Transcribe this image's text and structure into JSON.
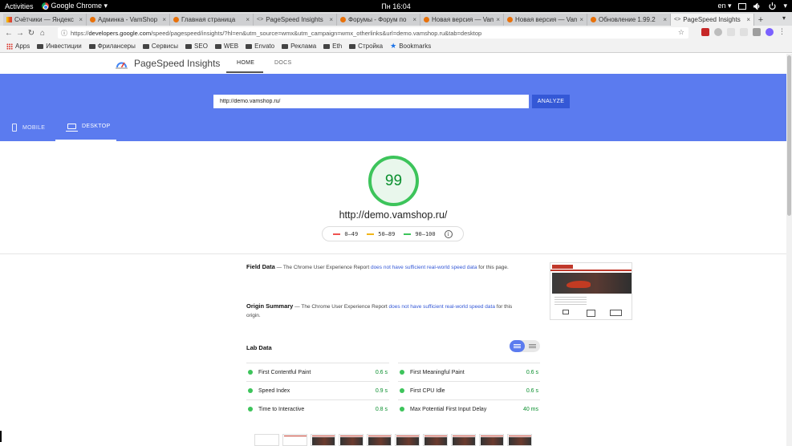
{
  "gnome": {
    "activities": "Activities",
    "app": "Google Chrome ▾",
    "clock": "Пн 16:04",
    "lang": "en ▾"
  },
  "tabs": [
    {
      "title": "Счётчики — Яндекс",
      "fav": "bars"
    },
    {
      "title": "Админка - VamShop",
      "fav": "dot"
    },
    {
      "title": "Главная страница",
      "fav": "dot"
    },
    {
      "title": "PageSpeed Insights",
      "fav": "code"
    },
    {
      "title": "Форумы - Форум по",
      "fav": "dot"
    },
    {
      "title": "Новая версия — Vam",
      "fav": "dot"
    },
    {
      "title": "Новая версия — Vam",
      "fav": "dot"
    },
    {
      "title": "Обновление 1.99.2",
      "fav": "dot"
    },
    {
      "title": "PageSpeed Insights",
      "fav": "code",
      "active": true
    }
  ],
  "address": {
    "scheme": "https://",
    "host": "developers.google.com",
    "path": "/speed/pagespeed/insights/?hl=en&utm_source=wmx&utm_campaign=wmx_otherlinks&url=demo.vamshop.ru&tab=desktop"
  },
  "bookmarks": [
    "Apps",
    "Инвестиции",
    "Фрилансеры",
    "Сервисы",
    "SEO",
    "WEB",
    "Envato",
    "Реклама",
    "Eth",
    "Стройка",
    "Bookmarks"
  ],
  "psi": {
    "brand": "PageSpeed Insights",
    "nav_home": "HOME",
    "nav_docs": "DOCS",
    "url_value": "http://demo.vamshop.ru/",
    "analyze": "ANALYZE",
    "tab_mobile": "MOBILE",
    "tab_desktop": "DESKTOP",
    "score": "99",
    "tested_url": "http://demo.vamshop.ru/",
    "legend": [
      {
        "label": "0–49",
        "color": "#ef5350"
      },
      {
        "label": "50–89",
        "color": "#f2b519"
      },
      {
        "label": "90–100",
        "color": "#3dc45b"
      }
    ],
    "info_glyph": "i",
    "field": {
      "title": "Field Data",
      "dash": " — The Chrome User Experience Report ",
      "link": "does not have sufficient real-world speed data",
      "tail": " for this page."
    },
    "origin": {
      "title": "Origin Summary",
      "dash": " — The Chrome User Experience Report ",
      "link": "does not have sufficient real-world speed data",
      "tail": " for this origin."
    },
    "lab_title": "Lab Data",
    "metrics_left": [
      {
        "name": "First Contentful Paint",
        "value": "0.6 s"
      },
      {
        "name": "Speed Index",
        "value": "0.9 s"
      },
      {
        "name": "Time to Interactive",
        "value": "0.8 s"
      }
    ],
    "metrics_right": [
      {
        "name": "First Meaningful Paint",
        "value": "0.6 s"
      },
      {
        "name": "First CPU Idle",
        "value": "0.6 s"
      },
      {
        "name": "Max Potential First Input Delay",
        "value": "40 ms"
      }
    ]
  }
}
